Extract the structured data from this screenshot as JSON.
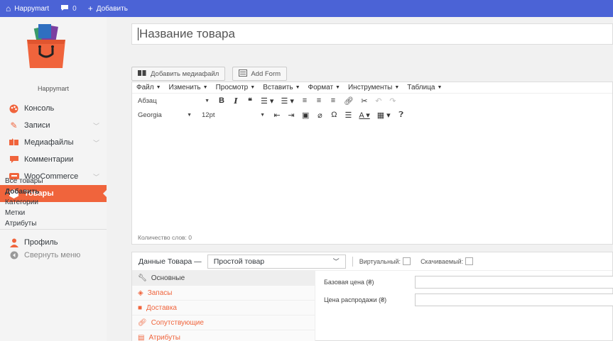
{
  "adminbar": {
    "site_name": "Happymart",
    "comments_count": "0",
    "add_label": "Добавить"
  },
  "sidebar": {
    "site_name": "Happymart",
    "items": [
      {
        "label": "Консоль",
        "icon": "palette-icon"
      },
      {
        "label": "Записи",
        "icon": "pin-icon"
      },
      {
        "label": "Медиафайлы",
        "icon": "media-icon"
      },
      {
        "label": "Комментарии",
        "icon": "comment-icon"
      },
      {
        "label": "WooCommerce",
        "icon": "woo-icon"
      },
      {
        "label": "Товары",
        "icon": "box-icon"
      }
    ],
    "submenu": [
      "Все товары",
      "Добавить",
      "Категории",
      "Метки",
      "Атрибуты"
    ],
    "profile_label": "Профиль",
    "collapse_label": "Свернуть меню"
  },
  "title": {
    "placeholder": "Название товара"
  },
  "media": {
    "add_media_label": "Добавить медиафайл",
    "add_form_label": "Add Form"
  },
  "editor": {
    "menus": [
      "Файл",
      "Изменить",
      "Просмотр",
      "Вставить",
      "Формат",
      "Инструменты",
      "Таблица"
    ],
    "format_select": "Абзац",
    "font_select": "Georgia",
    "size_select": "12pt",
    "word_count": "Количество слов: 0"
  },
  "product_data": {
    "heading": "Данные Товара —",
    "type_value": "Простой товар",
    "virtual_label": "Виртуальный:",
    "downloadable_label": "Скачиваемый:",
    "tabs": [
      "Основные",
      "Запасы",
      "Доставка",
      "Сопутствующие",
      "Атрибуты"
    ],
    "regular_price_label": "Базовая цена (₴)",
    "sale_price_label": "Цена распродажи (₴)"
  },
  "colors": {
    "adminbar": "#4b63d6",
    "accent": "#f0643c"
  }
}
